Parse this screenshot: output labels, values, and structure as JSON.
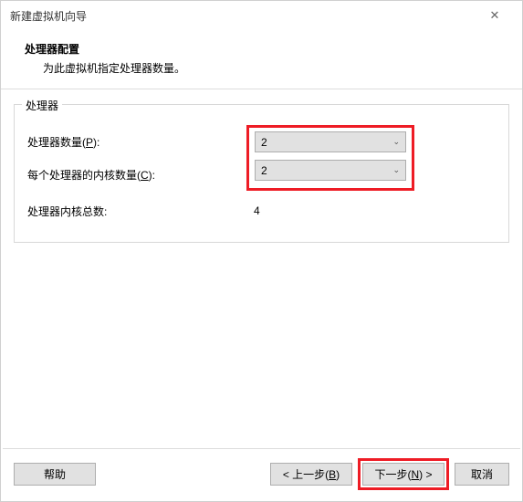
{
  "window": {
    "title": "新建虚拟机向导"
  },
  "header": {
    "title": "处理器配置",
    "subtitle": "为此虚拟机指定处理器数量。"
  },
  "group": {
    "legend": "处理器",
    "rows": {
      "procCount": {
        "label_pre": "处理器数量(",
        "hotkey": "P",
        "label_post": "):",
        "value": "2"
      },
      "coresPer": {
        "label_pre": "每个处理器的内核数量(",
        "hotkey": "C",
        "label_post": "):",
        "value": "2"
      },
      "totalCores": {
        "label": "处理器内核总数:",
        "value": "4"
      }
    }
  },
  "footer": {
    "help": "帮助",
    "back_pre": "< 上一步(",
    "back_hotkey": "B",
    "back_post": ")",
    "next_prefix": "下一步(",
    "next_hotkey": "N",
    "next_suffix": ") >",
    "cancel": "取消"
  },
  "colors": {
    "highlight": "#ee1c25"
  }
}
